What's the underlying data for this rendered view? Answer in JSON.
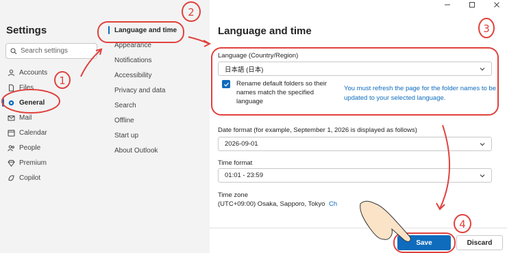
{
  "settings": {
    "title": "Settings",
    "search_placeholder": "Search settings",
    "nav": [
      {
        "label": "Accounts",
        "icon": "person-icon"
      },
      {
        "label": "Files",
        "icon": "file-icon"
      },
      {
        "label": "General",
        "icon": "gear-icon",
        "active": true
      },
      {
        "label": "Mail",
        "icon": "mail-icon"
      },
      {
        "label": "Calendar",
        "icon": "calendar-icon"
      },
      {
        "label": "People",
        "icon": "people-icon"
      },
      {
        "label": "Premium",
        "icon": "diamond-icon"
      },
      {
        "label": "Copilot",
        "icon": "copilot-icon"
      }
    ]
  },
  "general_nav": [
    {
      "label": "Language and time",
      "active": true
    },
    {
      "label": "Appearance"
    },
    {
      "label": "Notifications"
    },
    {
      "label": "Accessibility"
    },
    {
      "label": "Privacy and data"
    },
    {
      "label": "Search"
    },
    {
      "label": "Offline"
    },
    {
      "label": "Start up"
    },
    {
      "label": "About Outlook"
    }
  ],
  "main": {
    "title": "Language and time",
    "language_label": "Language (Country/Region)",
    "language_value": "日本語 (日本)",
    "rename_checkbox_label": "Rename default folders so their names match the specified language",
    "rename_checked": true,
    "refresh_notice": "You must refresh the page for the folder names to be updated to your selected language.",
    "date_format_label": "Date format (for example, September 1, 2026 is displayed as follows)",
    "date_format_value": "2026-09-01",
    "time_format_label": "Time format",
    "time_format_value": "01:01 - 23:59",
    "time_zone_label": "Time zone",
    "time_zone_value": "(UTC+09:00) Osaka, Sapporo, Tokyo",
    "time_zone_link": "Ch",
    "save_label": "Save",
    "discard_label": "Discard"
  },
  "annotations": {
    "step1": "1",
    "step2": "2",
    "step3": "3",
    "step4": "4"
  },
  "colors": {
    "accent": "#0f6cbd",
    "annotation": "#e0413d"
  }
}
